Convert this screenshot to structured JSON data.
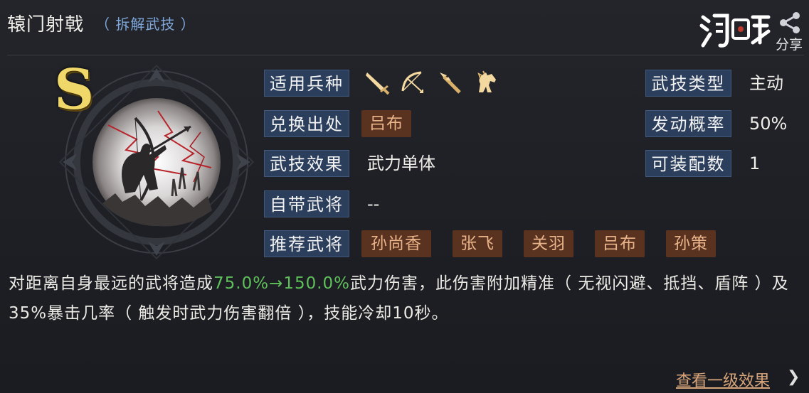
{
  "header": {
    "title": "辕门射戟",
    "subtitle": "（ 拆解武技 ）",
    "share_label": "分享"
  },
  "skill": {
    "grade": "S",
    "labels": {
      "troop_type": "适用兵种",
      "source": "兑换出处",
      "effect": "武技效果",
      "own_general": "自带武将",
      "recommended": "推荐武将",
      "skill_type": "武技类型",
      "trigger_rate": "发动概率",
      "equip_count": "可装配数"
    },
    "troop_icons": [
      "sword-icon",
      "bow-icon",
      "spear-icon",
      "horse-icon"
    ],
    "source_value": "吕布",
    "effect_value": "武力单体",
    "own_general_value": "--",
    "recommended_generals": [
      "孙尚香",
      "张飞",
      "关羽",
      "吕布",
      "孙策"
    ],
    "skill_type_value": "主动",
    "trigger_rate_value": "50%",
    "equip_count_value": "1"
  },
  "description": {
    "part1": "对距离自身最远的武将造成",
    "highlight": "75.0%→150.0%",
    "part2": "武力伤害，此伤害附加精准（ 无视闪避、抵挡、盾阵 ）及35%暴击几率（ 触发时武力伤害翻倍 ），技能冷却10秒。"
  },
  "footer": {
    "more_label": "查看一级效果",
    "arrow": "❯"
  },
  "colors": {
    "label_bg": "#2b3e5c",
    "tag_bg": "#5a3320",
    "tag_text": "#e9b48a",
    "highlight": "#5fbf5a",
    "subtitle": "#7ea6d8",
    "grade": "#f0d76a"
  }
}
